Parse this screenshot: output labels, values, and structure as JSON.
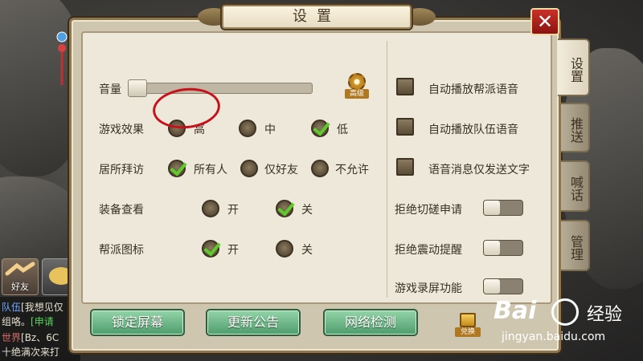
{
  "dialog": {
    "title": "设置",
    "close_glyph": "✕"
  },
  "tabs": [
    {
      "label": "设置",
      "active": true
    },
    {
      "label": "推送",
      "active": false
    },
    {
      "label": "喊话",
      "active": false
    },
    {
      "label": "管理",
      "active": false
    }
  ],
  "left": {
    "volume_label": "音量",
    "volume_level": 0,
    "hd_button_label": "高级",
    "effect": {
      "label": "游戏效果",
      "options": [
        "高",
        "中",
        "低"
      ],
      "selected": "低"
    },
    "visit": {
      "label": "居所拜访",
      "options": [
        "所有人",
        "仅好友",
        "不允许"
      ],
      "selected": "所有人"
    },
    "equip": {
      "label": "装备查看",
      "options": [
        "开",
        "关"
      ],
      "selected": "关"
    },
    "guild_icon": {
      "label": "帮派图标",
      "options": [
        "开",
        "关"
      ],
      "selected": "开"
    }
  },
  "right": {
    "checkboxes": [
      {
        "label": "自动播放帮派语音",
        "checked": false
      },
      {
        "label": "自动播放队伍语音",
        "checked": false
      },
      {
        "label": "语音消息仅发送文字",
        "checked": false
      }
    ],
    "toggles": [
      {
        "label": "拒绝切磋申请",
        "on": false
      },
      {
        "label": "拒绝震动提醒",
        "on": false
      },
      {
        "label": "游戏录屏功能",
        "on": false
      }
    ]
  },
  "buttons": {
    "lock": "锁定屏幕",
    "notice": "更新公告",
    "network": "网络检测",
    "gift": "兑换"
  },
  "background": {
    "friend_label": "好友",
    "chat": [
      {
        "tag": "队伍",
        "text": "[我想见仅"
      },
      {
        "tag": "",
        "text": "组咯。",
        "extra": "[申请"
      },
      {
        "tag": "世界",
        "text": "[Bz、6C"
      },
      {
        "tag": "",
        "text": "十绝满次来打"
      }
    ]
  },
  "watermark": {
    "logo": "Bai",
    "suffix": "经验",
    "url": "jingyan.baidu.com"
  },
  "colors": {
    "accent_check": "#5fcb2b",
    "annotation": "#c8101a",
    "button_green": "#4e9c6c"
  }
}
